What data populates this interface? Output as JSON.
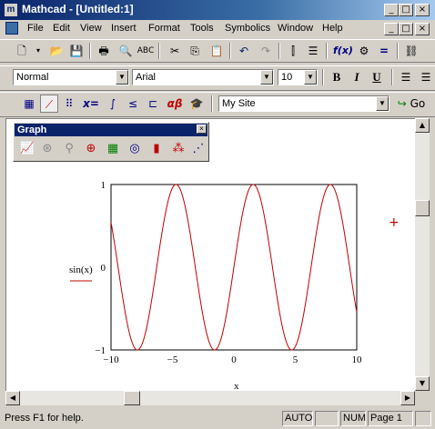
{
  "window": {
    "title": "Mathcad - [Untitled:1]",
    "controls": [
      "_",
      "□",
      "×"
    ]
  },
  "menu": [
    "File",
    "Edit",
    "View",
    "Insert",
    "Format",
    "Tools",
    "Symbolics",
    "Window",
    "Help"
  ],
  "format_toolbar": {
    "style": "Normal",
    "font": "Arial",
    "size": "10",
    "bold": "B",
    "italic": "I",
    "underline": "U"
  },
  "math_toolbar": {
    "site": "My Site",
    "go_label": "Go",
    "xeq": "x=",
    "alpha_beta": "αβ"
  },
  "graph_palette": {
    "title": "Graph",
    "close": "×"
  },
  "plot": {
    "y_expr": "sin(x)",
    "x_var": "x",
    "y_ticks": [
      "1",
      "0",
      "−1"
    ],
    "x_ticks": [
      "−10",
      "−5",
      "0",
      "5",
      "10"
    ],
    "marker": "+"
  },
  "chart_data": {
    "type": "line",
    "function": "sin(x)",
    "xlabel": "x",
    "ylabel": "sin(x)",
    "xlim": [
      -10,
      10
    ],
    "ylim": [
      -1,
      1
    ],
    "color": "#c00000"
  },
  "status": {
    "help": "Press F1 for help.",
    "mode": "AUTO",
    "num": "NUM",
    "page": "Page 1"
  },
  "colors": {
    "title_start": "#0a246a",
    "trace": "#c00000",
    "face": "#d4d0c8"
  }
}
